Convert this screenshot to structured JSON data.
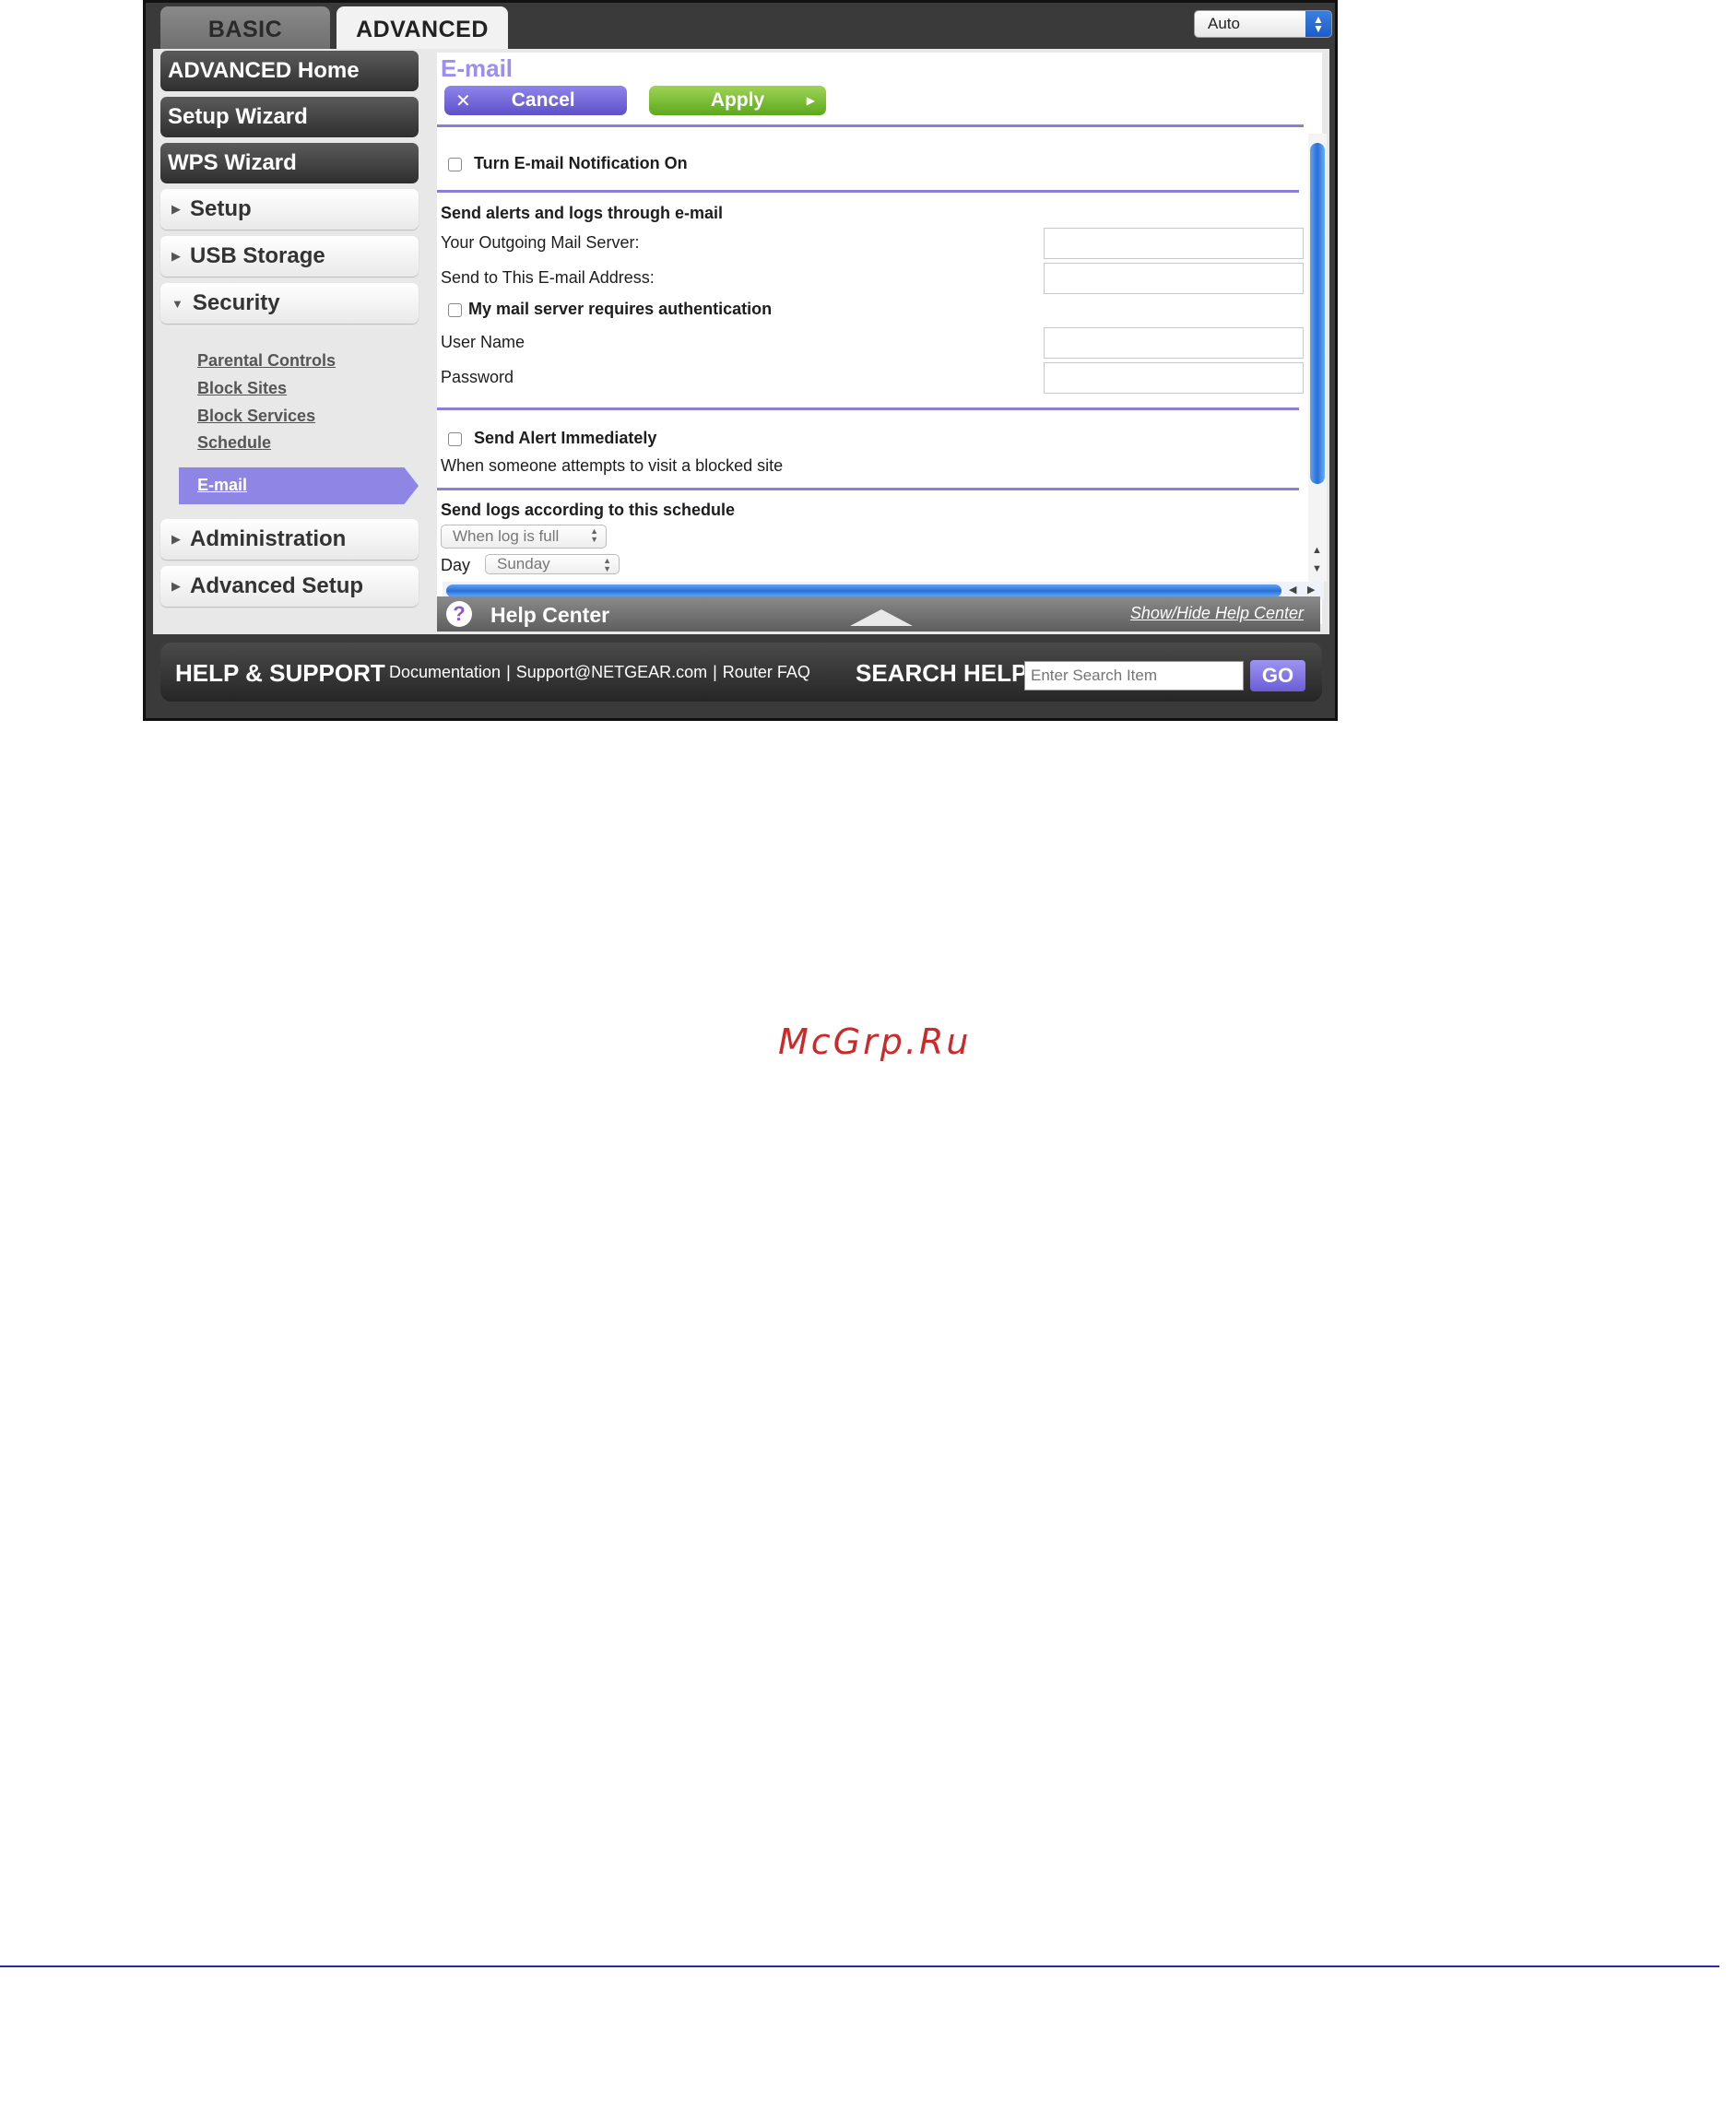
{
  "tabs": {
    "basic": "BASIC",
    "advanced": "ADVANCED"
  },
  "language_select": {
    "value": "Auto"
  },
  "sidebar": {
    "dark_items": [
      "ADVANCED Home",
      "Setup Wizard",
      "WPS Wizard"
    ],
    "items": [
      "Setup",
      "USB Storage",
      "Security",
      "Administration",
      "Advanced Setup"
    ],
    "security_sub_items": [
      "Parental Controls",
      "Block Sites",
      "Block Services",
      "Schedule",
      "E-mail"
    ]
  },
  "content": {
    "title": "E-mail",
    "cancel_label": "Cancel",
    "apply_label": "Apply",
    "turn_on_label": "Turn E-mail Notification On",
    "send_alerts_heading": "Send alerts and logs through e-mail",
    "outgoing_server_label": "Your Outgoing Mail Server:",
    "send_to_label": "Send to This E-mail Address:",
    "auth_label": "My mail server requires authentication",
    "username_label": "User Name",
    "password_label": "Password",
    "send_alert_label": "Send Alert Immediately",
    "alert_desc": "When someone attempts to visit a blocked site",
    "schedule_heading": "Send logs according to this schedule",
    "schedule_select": "When log is full",
    "day_label": "Day",
    "day_select": "Sunday"
  },
  "help_center": {
    "label": "Help Center",
    "toggle": "Show/Hide Help Center"
  },
  "footer": {
    "title": "HELP & SUPPORT",
    "links": [
      "Documentation",
      "Support@NETGEAR.com",
      "Router FAQ"
    ],
    "search_title": "SEARCH HELP",
    "search_placeholder": "Enter Search Item",
    "go_label": "GO"
  },
  "watermark": "McGrp.Ru",
  "colors": {
    "accent_purple": "#8f85e4",
    "apply_green": "#6fb92a",
    "title_purple": "#9a8ef0",
    "watermark_red": "#cc2a2a"
  }
}
